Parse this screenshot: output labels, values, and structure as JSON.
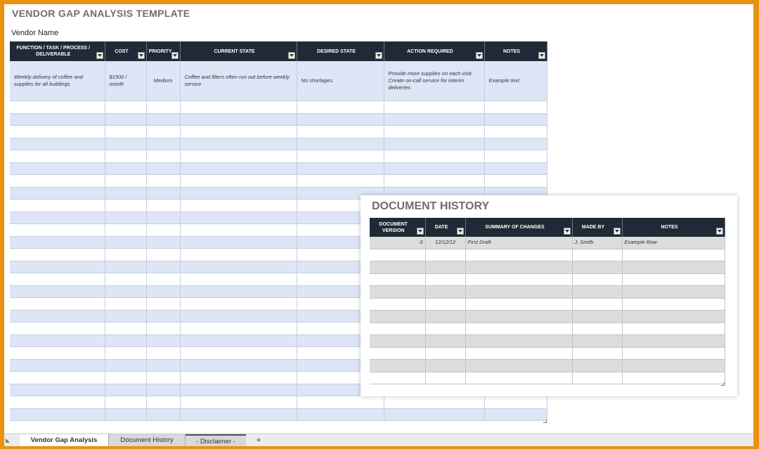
{
  "title": "VENDOR GAP ANALYSIS TEMPLATE",
  "vendor_label": "Vendor Name",
  "main_table": {
    "headers": [
      "FUNCTION / TASK / PROCESS / DELIVERABLE",
      "COST",
      "PRIORITY",
      "CURRENT STATE",
      "DESIRED STATE",
      "ACTION REQUIRED",
      "NOTES"
    ],
    "first_row": {
      "function": "Weekly delivery of coffee and supplies for all buildings",
      "cost": "$1500 / month",
      "priority": "Medium",
      "current_state": "Coffee and filters often run out before weekly service",
      "desired_state": "No shortages.",
      "action_required": "Provide more supplies on each visit.\nCreate on-call service for interim deliveries",
      "notes": "Example text"
    }
  },
  "document_history": {
    "title": "DOCUMENT HISTORY",
    "headers": [
      "DOCUMENT VERSION",
      "DATE",
      "SUMMARY OF CHANGES",
      "MADE BY",
      "NOTES"
    ],
    "first_row": {
      "version": "0",
      "date": "12/12/12",
      "summary": "First Draft",
      "made_by": "J. Smith",
      "notes": "Example Row"
    }
  },
  "tabs": [
    {
      "label": "Vendor Gap Analysis",
      "active": true
    },
    {
      "label": "Document History",
      "active": false
    },
    {
      "label": "- Disclaimer -",
      "active": false
    }
  ],
  "tab_add": "+"
}
